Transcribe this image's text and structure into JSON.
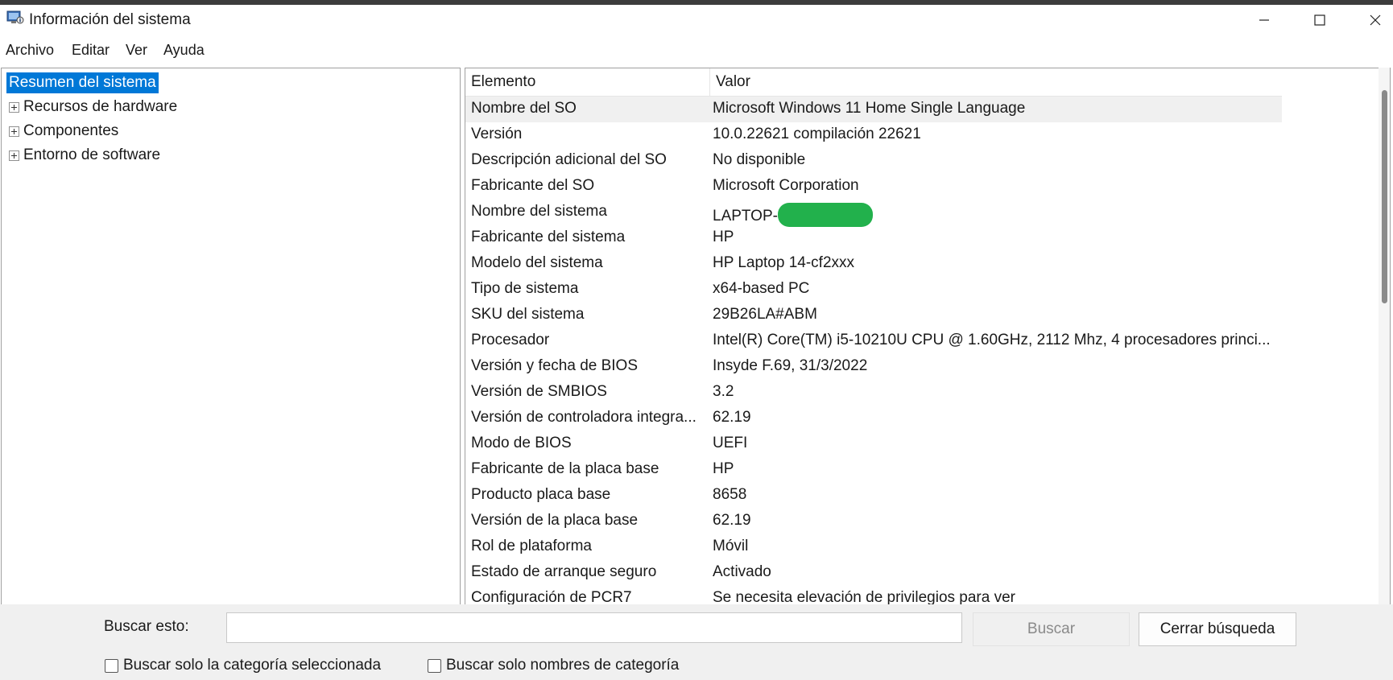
{
  "window": {
    "title": "Información del sistema"
  },
  "menu": [
    "Archivo",
    "Editar",
    "Ver",
    "Ayuda"
  ],
  "tree": {
    "selected": "Resumen del sistema",
    "items": [
      "Recursos de hardware",
      "Componentes",
      "Entorno de software"
    ]
  },
  "list": {
    "headers": {
      "element": "Elemento",
      "value": "Valor"
    },
    "rows": [
      {
        "element": "Nombre del SO",
        "value": "Microsoft Windows 11 Home Single Language"
      },
      {
        "element": "Versión",
        "value": "10.0.22621 compilación 22621"
      },
      {
        "element": "Descripción adicional del SO",
        "value": "No disponible"
      },
      {
        "element": "Fabricante del SO",
        "value": "Microsoft Corporation"
      },
      {
        "element": "Nombre del sistema",
        "value": "LAPTOP-"
      },
      {
        "element": "Fabricante del sistema",
        "value": "HP"
      },
      {
        "element": "Modelo del sistema",
        "value": "HP Laptop 14-cf2xxx"
      },
      {
        "element": "Tipo de sistema",
        "value": "x64-based PC"
      },
      {
        "element": "SKU del sistema",
        "value": "29B26LA#ABM"
      },
      {
        "element": "Procesador",
        "value": "Intel(R) Core(TM) i5-10210U CPU @ 1.60GHz, 2112 Mhz, 4 procesadores princi..."
      },
      {
        "element": "Versión y fecha de BIOS",
        "value": "Insyde F.69, 31/3/2022"
      },
      {
        "element": "Versión de SMBIOS",
        "value": "3.2"
      },
      {
        "element": "Versión de controladora integra...",
        "value": "62.19"
      },
      {
        "element": "Modo de BIOS",
        "value": "UEFI"
      },
      {
        "element": "Fabricante de la placa base",
        "value": "HP"
      },
      {
        "element": "Producto placa base",
        "value": "8658"
      },
      {
        "element": "Versión de la placa base",
        "value": "62.19"
      },
      {
        "element": "Rol de plataforma",
        "value": "Móvil"
      },
      {
        "element": "Estado de arranque seguro",
        "value": "Activado"
      },
      {
        "element": "Configuración de PCR7",
        "value": "Se necesita elevación de privilegios para ver"
      }
    ]
  },
  "search": {
    "label": "Buscar esto:",
    "value": "",
    "buscar_label": "Buscar",
    "cerrar_label": "Cerrar búsqueda",
    "chk_selected_label": "Buscar solo la categoría seleccionada",
    "chk_names_label": "Buscar solo nombres de categoría"
  },
  "colors": {
    "selection": "#0078d7",
    "redaction": "#22b14c"
  }
}
